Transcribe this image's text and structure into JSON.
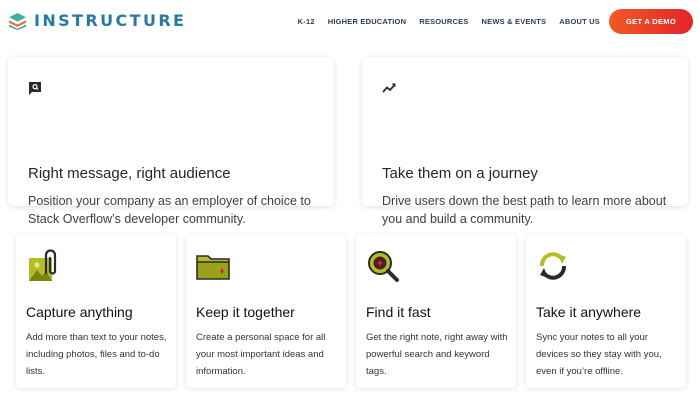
{
  "header": {
    "logo_text": "INSTRUCTURE",
    "logo_colors": [
      "#3fb0a6",
      "#f26f21",
      "#287a9f"
    ],
    "nav_items": [
      "K-12",
      "HIGHER EDUCATION",
      "RESOURCES",
      "NEWS & EVENTS",
      "ABOUT US"
    ],
    "cta_label": "GET A DEMO",
    "cta_colors": [
      "#f05a26",
      "#e3242b"
    ]
  },
  "features_top": [
    {
      "icon": "message-icon",
      "title": "Right message, right audience",
      "description": "Position your company as an employer of choice to Stack Overflow’s developer community."
    },
    {
      "icon": "trending-up-icon",
      "title": "Take them on a journey",
      "description": "Drive users down the best path to learn more about you and build a community."
    }
  ],
  "features_bottom": [
    {
      "icon": "attachment-icon",
      "title": "Capture anything",
      "description": "Add more than text to your notes, including photos, files and to-do lists."
    },
    {
      "icon": "folder-icon",
      "title": "Keep it together",
      "description": "Create a personal space for all your most important ideas and information."
    },
    {
      "icon": "search-icon",
      "title": "Find it fast",
      "description": "Get the right note, right away with powerful search and keyword tags."
    },
    {
      "icon": "sync-icon",
      "title": "Take it anywhere",
      "description": "Sync your notes to all your devices so they stay with you, even if you’re offline."
    }
  ],
  "icon_accent_color": "#b5bd26"
}
